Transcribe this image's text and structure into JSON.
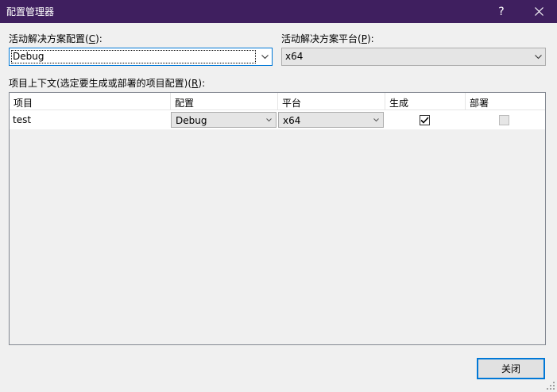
{
  "window": {
    "title": "配置管理器",
    "help_label": "?",
    "close_icon": "close-icon"
  },
  "solution_config": {
    "label_prefix": "活动解决方案配置(",
    "label_key": "C",
    "label_suffix": "):",
    "value": "Debug"
  },
  "solution_platform": {
    "label_prefix": "活动解决方案平台(",
    "label_key": "P",
    "label_suffix": "):",
    "value": "x64"
  },
  "project_contexts": {
    "label_prefix": "项目上下文(选定要生成或部署的项目配置)(",
    "label_key": "R",
    "label_suffix": "):",
    "columns": [
      "项目",
      "配置",
      "平台",
      "生成",
      "部署"
    ],
    "rows": [
      {
        "project": "test",
        "configuration": "Debug",
        "platform": "x64",
        "build": true,
        "deploy": false
      }
    ]
  },
  "buttons": {
    "close_label": "关闭"
  },
  "colors": {
    "titlebar": "#3f1f5f",
    "accent": "#0078d7"
  }
}
